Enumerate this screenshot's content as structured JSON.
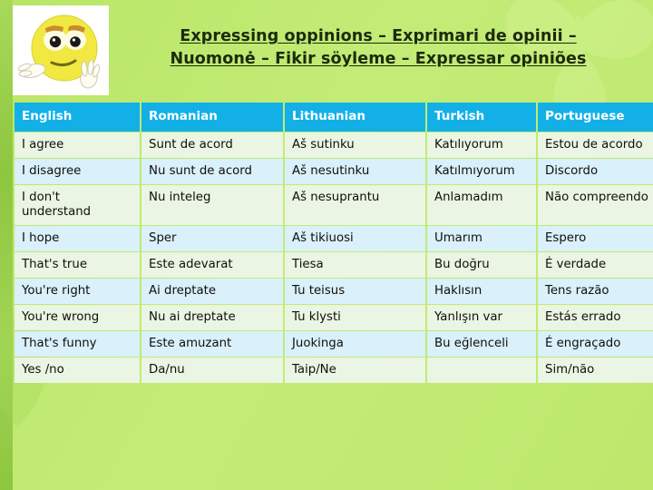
{
  "slide": {
    "background_color": "#bde86c",
    "left_band_color": "#8dc63f",
    "header_color": "#13b0e8",
    "row_color_a": "#eaf5e3",
    "row_color_b": "#daf0fa",
    "title_line1": "Expressing oppinions – Exprimari de opinii –",
    "title_line2": "Nuomonė – Fikir söyleme – Expressar opiniões",
    "emoji_icon": "confused-shrug-emoji"
  },
  "table": {
    "columns": [
      "English",
      "Romanian",
      "Lithuanian",
      "Turkish",
      "Portuguese"
    ],
    "rows": [
      [
        "I agree",
        "Sunt de acord",
        "Aš sutinku",
        "Katılıyorum",
        "Estou de acordo"
      ],
      [
        "I disagree",
        "Nu sunt de acord",
        "Aš nesutinku",
        "Katılmıyorum",
        "Discordo"
      ],
      [
        "I don't understand",
        "Nu inteleg",
        "Aš nesuprantu",
        "Anlamadım",
        "Não compreendo"
      ],
      [
        "I hope",
        "Sper",
        "Aš tikiuosi",
        "Umarım",
        "Espero"
      ],
      [
        "That's true",
        "Este adevarat",
        "Tiesa",
        "Bu doğru",
        "É verdade"
      ],
      [
        "You're right",
        "Ai dreptate",
        "Tu teisus",
        "Haklısın",
        "Tens razão"
      ],
      [
        "You're wrong",
        "Nu ai dreptate",
        "Tu klysti",
        "Yanlışın var",
        "Estás errado"
      ],
      [
        "That's funny",
        "Este amuzant",
        "Juokinga",
        "Bu eğlenceli",
        "É engraçado"
      ],
      [
        "Yes /no",
        "Da/nu",
        "Taip/Ne",
        "",
        "Sim/não"
      ]
    ]
  }
}
